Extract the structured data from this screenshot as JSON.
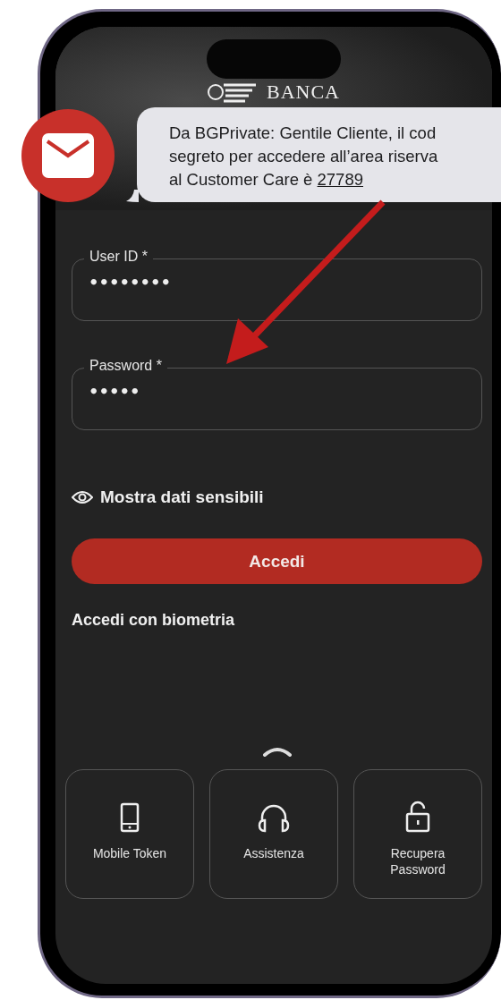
{
  "notification": {
    "lines": [
      "Da BGPrivate: Gentile Cliente, il cod",
      "segreto per accedere all’area riserva",
      "al Customer Care è "
    ],
    "code": "27789"
  },
  "logo": {
    "text": "BANCA"
  },
  "fields": [
    {
      "label": "User ID *",
      "value": "••••••••"
    },
    {
      "label": "Password *",
      "value": "•••••"
    }
  ],
  "show_sensitive": {
    "label": "Mostra dati sensibili"
  },
  "login_button": "Accedi",
  "biometric_link": "Accedi con biometria",
  "tiles": [
    {
      "kind": "phone",
      "label": "Mobile Token"
    },
    {
      "kind": "headset",
      "label": "Assistenza"
    },
    {
      "kind": "unlock",
      "label": "Recupera Password"
    }
  ]
}
